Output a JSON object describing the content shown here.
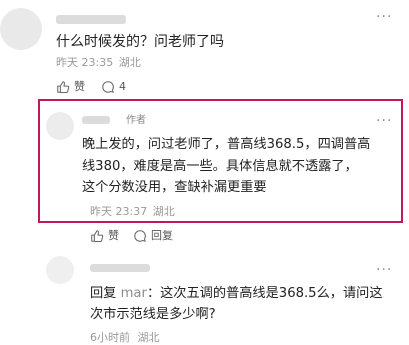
{
  "comment1": {
    "text": "什么时候发的？问老师了吗",
    "time": "昨天 23:35",
    "location": "湖北",
    "like_label": "赞",
    "reply_count": "4"
  },
  "comment2": {
    "author_tag": "作者",
    "text_line1": "晚上发的，问过老师了，普高线368.5，四调普高",
    "text_line2": "线380，难度是高一些。具体信息就不透露了，",
    "text_line3": "这个分数没用，查缺补漏更重要",
    "time": "昨天 23:37",
    "location": "湖北",
    "like_label": "赞",
    "reply_label": "回复"
  },
  "comment3": {
    "reply_prefix": "回复",
    "reply_to": "mar",
    "text_line1_rest": "：这次五调的普高线是368.5么，请问这",
    "text_line2": "次市示范线是多少啊?",
    "time": "6小时前",
    "location": "湖北"
  },
  "more_glyph": "···"
}
